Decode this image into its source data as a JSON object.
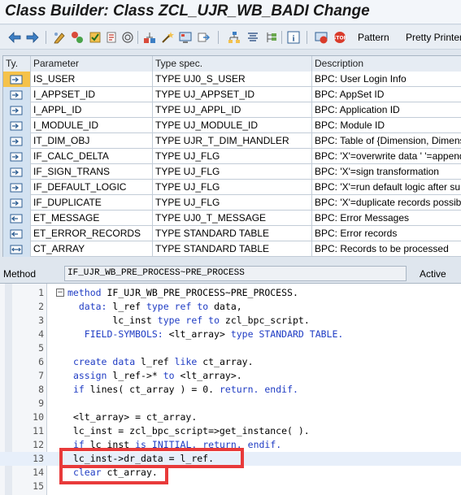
{
  "window": {
    "title": "Class Builder: Class ZCL_UJR_WB_BADI Change"
  },
  "toolbar": {
    "pattern_label": "Pattern",
    "pretty_printer_label": "Pretty Printer"
  },
  "grid": {
    "headers": {
      "type": "Ty.",
      "parameter": "Parameter",
      "type_spec": "Type spec.",
      "description": "Description"
    },
    "rows": [
      {
        "parameter": "IS_USER",
        "type_spec": "TYPE UJ0_S_USER",
        "description": "BPC: User Login Info",
        "dir": "importing"
      },
      {
        "parameter": "I_APPSET_ID",
        "type_spec": "TYPE UJ_APPSET_ID",
        "description": "BPC: AppSet ID",
        "dir": "importing"
      },
      {
        "parameter": "I_APPL_ID",
        "type_spec": "TYPE UJ_APPL_ID",
        "description": "BPC: Application ID",
        "dir": "importing"
      },
      {
        "parameter": "I_MODULE_ID",
        "type_spec": "TYPE UJ_MODULE_ID",
        "description": "BPC: Module ID",
        "dir": "importing"
      },
      {
        "parameter": "IT_DIM_OBJ",
        "type_spec": "TYPE UJR_T_DIM_HANDLER",
        "description": "BPC: Table of {Dimension, Dimension",
        "dir": "importing"
      },
      {
        "parameter": "IF_CALC_DELTA",
        "type_spec": "TYPE UJ_FLG",
        "description": "BPC: 'X'=overwrite data ' '=append",
        "dir": "importing"
      },
      {
        "parameter": "IF_SIGN_TRANS",
        "type_spec": "TYPE UJ_FLG",
        "description": "BPC: 'X'=sign transformation",
        "dir": "importing"
      },
      {
        "parameter": "IF_DEFAULT_LOGIC",
        "type_spec": "TYPE UJ_FLG",
        "description": "BPC: 'X'=run default logic after su",
        "dir": "importing"
      },
      {
        "parameter": "IF_DUPLICATE",
        "type_spec": "TYPE UJ_FLG",
        "description": "BPC: 'X'=duplicate records possible",
        "dir": "importing"
      },
      {
        "parameter": "ET_MESSAGE",
        "type_spec": "TYPE UJ0_T_MESSAGE",
        "description": "BPC: Error Messages",
        "dir": "exporting"
      },
      {
        "parameter": "ET_ERROR_RECORDS",
        "type_spec": "TYPE STANDARD TABLE",
        "description": "BPC: Error records",
        "dir": "exporting"
      },
      {
        "parameter": "CT_ARRAY",
        "type_spec": "TYPE STANDARD TABLE",
        "description": "BPC: Records to be processed",
        "dir": "changing"
      }
    ]
  },
  "method_bar": {
    "label": "Method",
    "value": "IF_UJR_WB_PRE_PROCESS~PRE_PROCESS",
    "status": "Active"
  },
  "editor": {
    "lines": [
      {
        "num": "1",
        "text": "method IF_UJR_WB_PRE_PROCESS~PRE_PROCESS."
      },
      {
        "num": "2",
        "text": "  data: l_ref type ref to data,"
      },
      {
        "num": "3",
        "text": "        lc_inst type ref to zcl_bpc_script."
      },
      {
        "num": "4",
        "text": "   FIELD-SYMBOLS: <lt_array> type STANDARD TABLE."
      },
      {
        "num": "5",
        "text": ""
      },
      {
        "num": "6",
        "text": " create data l_ref like ct_array."
      },
      {
        "num": "7",
        "text": " assign l_ref->* to <lt_array>."
      },
      {
        "num": "8",
        "text": " if lines( ct_array ) = 0. return. endif."
      },
      {
        "num": "9",
        "text": ""
      },
      {
        "num": "10",
        "text": " <lt_array> = ct_array."
      },
      {
        "num": "11",
        "text": " lc_inst = zcl_bpc_script=>get_instance( )."
      },
      {
        "num": "12",
        "text": " if lc_inst is INITIAL. return. endif."
      },
      {
        "num": "13",
        "text": " lc_inst->dr_data = l_ref."
      },
      {
        "num": "14",
        "text": " clear ct_array."
      },
      {
        "num": "15",
        "text": ""
      }
    ]
  },
  "colors": {
    "highlight": "#e83a3a",
    "keyword": "#1f3cc4",
    "selected_row_icon": "#f5c24a"
  }
}
